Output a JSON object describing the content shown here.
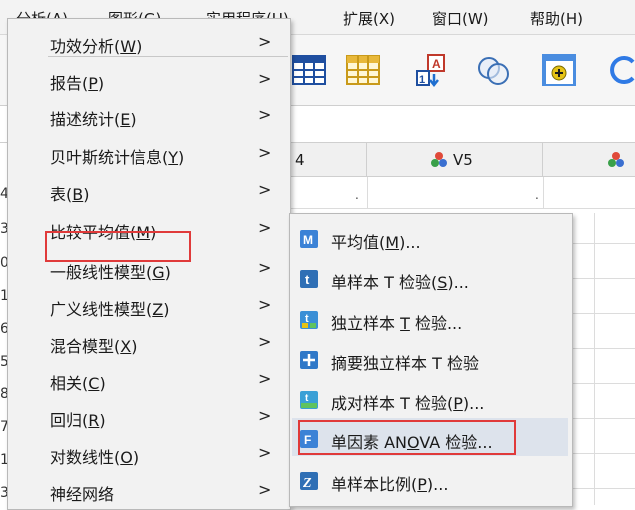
{
  "menubar": {
    "items": [
      {
        "label": "分析(A)",
        "key": "A"
      },
      {
        "label": "图形(G)",
        "key": "G"
      },
      {
        "label": "实用程序(U)",
        "key": "U"
      },
      {
        "label": "扩展(X)",
        "key": "X"
      },
      {
        "label": "窗口(W)",
        "key": "W"
      },
      {
        "label": "帮助(H)",
        "key": "H"
      }
    ]
  },
  "grid": {
    "col4_label": "4",
    "col5_label": "V5",
    "row_numbers": [
      "4",
      "3",
      "0",
      "1",
      "6",
      "5",
      "8",
      "7",
      "1",
      "3"
    ],
    "missing_marks": [
      ".",
      "."
    ]
  },
  "analyze_menu": {
    "items": [
      {
        "label": "功效分析",
        "key": "W"
      },
      {
        "label": "报告",
        "key": "P"
      },
      {
        "label": "描述统计",
        "key": "E"
      },
      {
        "label": "贝叶斯统计信息",
        "key": "Y"
      },
      {
        "label": "表",
        "key": "B"
      },
      {
        "label": "比较平均值",
        "key": "M"
      },
      {
        "label": "一般线性模型",
        "key": "G"
      },
      {
        "label": "广义线性模型",
        "key": "Z"
      },
      {
        "label": "混合模型",
        "key": "X"
      },
      {
        "label": "相关",
        "key": "C"
      },
      {
        "label": "回归",
        "key": "R"
      },
      {
        "label": "对数线性",
        "key": "O"
      },
      {
        "label": "神经网络",
        "key": ""
      }
    ],
    "arrow": ">"
  },
  "compare_means_submenu": {
    "items": [
      {
        "label": "平均值",
        "key": "M",
        "suffix": "...",
        "icon": "means-icon",
        "icon_text": "M",
        "color": "#3b82d6"
      },
      {
        "label": "单样本 T 检验",
        "key": "S",
        "suffix": "...",
        "icon": "one-sample-t-icon",
        "icon_text": "t",
        "color": "#2f6fb5"
      },
      {
        "label": "独立样本 ",
        "key": "T",
        "tail": " 检验...",
        "icon": "independent-t-icon",
        "icon_text": "t",
        "color": "#3a8fd6"
      },
      {
        "label": "摘要独立样本 T 检验",
        "key": "",
        "suffix": "",
        "icon": "summary-t-icon",
        "icon_text": "+",
        "color": "#2f78c8"
      },
      {
        "label": "成对样本 T 检验",
        "key": "P",
        "suffix": "...",
        "icon": "paired-t-icon",
        "icon_text": "t",
        "color": "#3aa0d6"
      },
      {
        "label": "单因素 AN",
        "key": "O",
        "tail": "VA 检验...",
        "icon": "anova-icon",
        "icon_text": "F",
        "color": "#3b82d6"
      },
      {
        "label": "单样本比例",
        "key": "P",
        "suffix": "...",
        "icon": "one-sample-proportion-icon",
        "icon_text": "Z",
        "color": "#2f6fb5"
      }
    ]
  },
  "colors": {
    "highlight_border": "#e03a3a",
    "hover_bg": "#dde3ec",
    "menu_bg": "#f2f2f2"
  }
}
